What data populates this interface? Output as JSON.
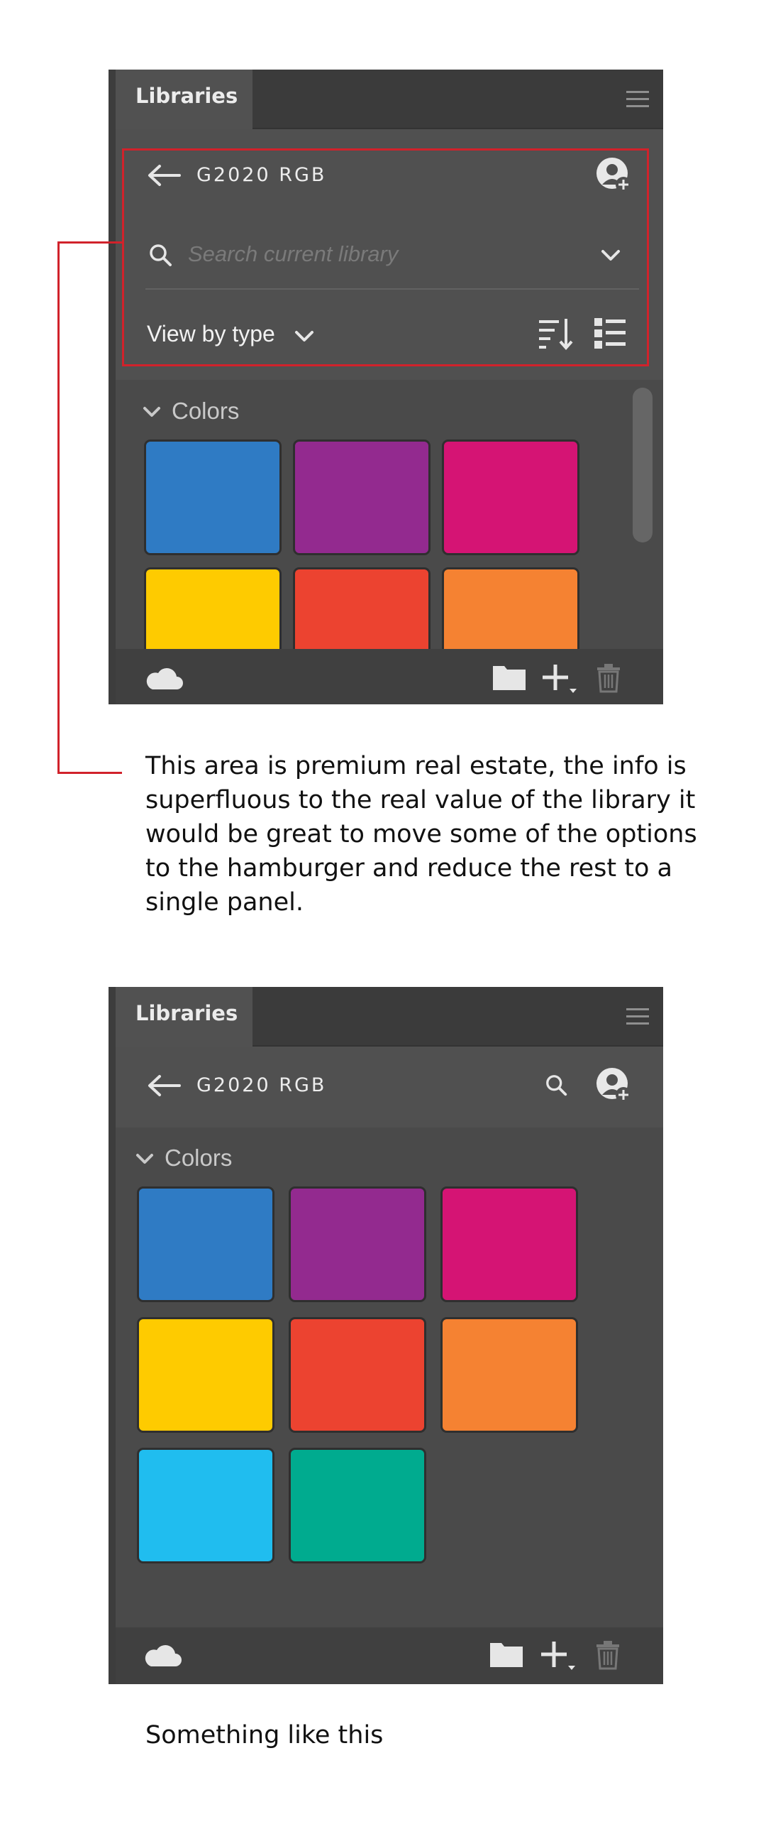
{
  "panel_top": {
    "tab_label": "Libraries",
    "library_name": "G2020 RGB",
    "search_placeholder": "Search current library",
    "view_by_label": "View by type",
    "section_title": "Colors",
    "colors": [
      "#2f7bc4",
      "#932a8f",
      "#d51474",
      "#fecb00",
      "#ec4330",
      "#f58232"
    ]
  },
  "annotation_text": "This area is premium real estate, the info is superfluous to the real value of the library it would be great to move some of the options to the hamburger and reduce the rest to a single panel.",
  "panel_bottom": {
    "tab_label": "Libraries",
    "library_name": "G2020 RGB",
    "section_title": "Colors",
    "colors": [
      "#2f7bc4",
      "#932a8f",
      "#d51474",
      "#fecb00",
      "#ec4330",
      "#f58232",
      "#20bdef",
      "#00ab8f"
    ]
  },
  "caption": "Something like this",
  "accent_color": "#d1222b"
}
